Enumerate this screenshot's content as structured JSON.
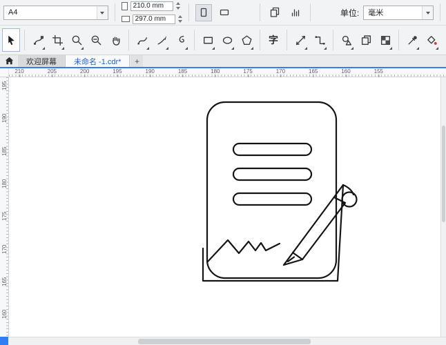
{
  "property_bar": {
    "page_size_value": "A4",
    "page_width": "210.0 mm",
    "page_height": "297.0 mm",
    "units_label": "单位:",
    "units_value": "毫米"
  },
  "tabs": {
    "items": [
      {
        "label": "欢迎屏幕",
        "active": false
      },
      {
        "label": "未命名 -1.cdr*",
        "active": true
      }
    ],
    "new_tab_label": "+"
  },
  "toolbox": {
    "text_tool_glyph": "字",
    "tools": [
      "pick",
      "shape-edit",
      "crop",
      "zoom",
      "zoom-out",
      "pan",
      "freehand",
      "artistic-media",
      "b-spline",
      "rectangle",
      "ellipse",
      "polygon",
      "text",
      "parallel-dimension",
      "connector",
      "common-shapes",
      "copy",
      "transparency-pattern",
      "color-eyedropper",
      "interactive-fill",
      "outline-pen"
    ]
  },
  "rulers": {
    "horizontal": [
      "210",
      "205",
      "200",
      "195",
      "190",
      "185",
      "180",
      "175",
      "170",
      "165",
      "160",
      "155"
    ],
    "vertical": [
      "195",
      "190",
      "185",
      "180",
      "175",
      "170",
      "165",
      "160"
    ]
  },
  "canvas": {
    "drawing": "document-with-text-lines-zigzag-tear-and-pencil-line-art"
  },
  "colors": {
    "accent_blue": "#2f7ff2",
    "tab_active_text": "#1f5fd0",
    "toolbar_bg": "#f2f3f4",
    "ink": "#141414",
    "tool_red": "#d43a3a"
  }
}
